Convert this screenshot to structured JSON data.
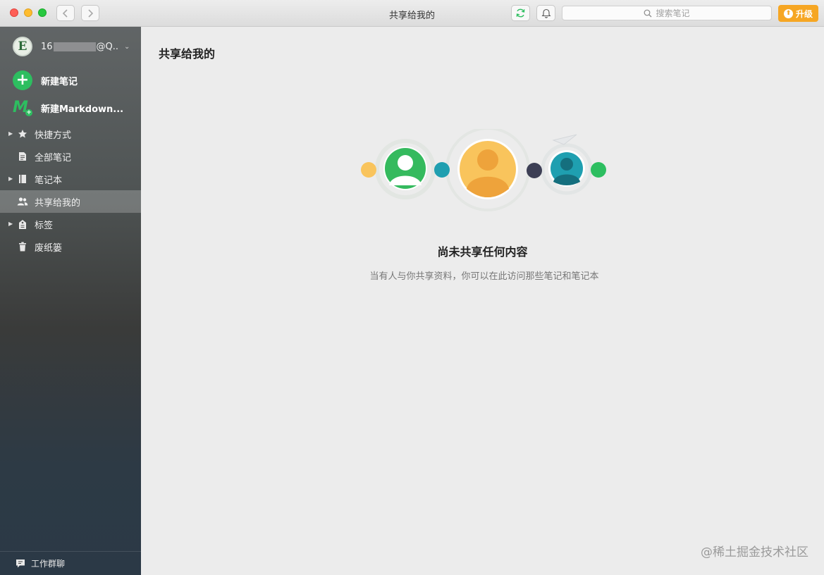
{
  "window": {
    "title": "共享给我的",
    "search_placeholder": "搜索笔记",
    "upgrade_label": "升级"
  },
  "icons": {
    "back": "chevron-left-icon",
    "forward": "chevron-right-icon",
    "sync": "sync-icon",
    "bell": "bell-icon",
    "search": "search-icon"
  },
  "sidebar": {
    "account": {
      "avatar_letter": "E",
      "name_prefix": "16",
      "name_suffix": "@Q..."
    },
    "new_note": "新建笔记",
    "new_markdown": "新建Markdown...",
    "items": [
      {
        "label": "快捷方式",
        "icon": "star-icon",
        "expandable": true
      },
      {
        "label": "全部笔记",
        "icon": "note-icon",
        "expandable": false
      },
      {
        "label": "笔记本",
        "icon": "notebook-icon",
        "expandable": true
      },
      {
        "label": "共享给我的",
        "icon": "users-icon",
        "expandable": false,
        "active": true
      },
      {
        "label": "标签",
        "icon": "tag-icon",
        "expandable": true
      },
      {
        "label": "废纸篓",
        "icon": "trash-icon",
        "expandable": false
      }
    ],
    "footer": "工作群聊"
  },
  "main": {
    "title": "共享给我的",
    "empty_title": "尚未共享任何内容",
    "empty_desc": "当有人与你共享资料，你可以在此访问那些笔记和笔记本"
  },
  "colors": {
    "accent_green": "#2dbe60",
    "upgrade_orange": "#f6a623",
    "teal": "#1f9fb0",
    "navy": "#3d3f55",
    "yellow": "#f9c45c"
  },
  "watermark": "@稀土掘金技术社区"
}
